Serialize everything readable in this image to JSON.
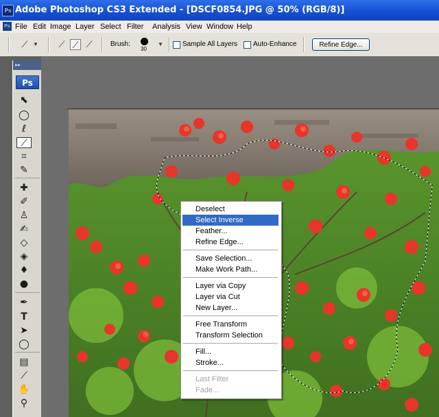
{
  "window": {
    "title": "Adobe Photoshop CS3 Extended - [DSCF0854.JPG @ 50% (RGB/8)]",
    "app_icon_text": "Ps"
  },
  "menubar": {
    "icon_text": "Ps",
    "items": [
      "File",
      "Edit",
      "Image",
      "Layer",
      "Select",
      "Filter",
      "Analysis",
      "View",
      "Window",
      "Help"
    ]
  },
  "options_bar": {
    "brush_label": "Brush:",
    "brush_size": "30",
    "sample_all_layers_label": "Sample All Layers",
    "sample_all_layers_checked": false,
    "auto_enhance_label": "Auto-Enhance",
    "auto_enhance_checked": false,
    "refine_edge_button": "Refine Edge..."
  },
  "toolbox": {
    "logo": "Ps",
    "tools": [
      "move-tool",
      "marquee-tool",
      "lasso-tool",
      "quick-selection-tool",
      "crop-tool",
      "slice-tool",
      "healing-brush-tool",
      "brush-tool",
      "clone-stamp-tool",
      "history-brush-tool",
      "eraser-tool",
      "paint-bucket-tool",
      "blur-tool",
      "dodge-tool",
      "pen-tool",
      "type-tool",
      "path-selection-tool",
      "shape-tool",
      "notes-tool",
      "eyedropper-tool",
      "hand-tool",
      "zoom-tool"
    ],
    "selected_tool": "quick-selection-tool"
  },
  "context_menu": {
    "items": [
      {
        "label": "Deselect",
        "state": "normal"
      },
      {
        "label": "Select Inverse",
        "state": "highlighted"
      },
      {
        "label": "Feather...",
        "state": "normal"
      },
      {
        "label": "Refine Edge...",
        "state": "normal"
      },
      {
        "label": "Save Selection...",
        "state": "normal"
      },
      {
        "label": "Make Work Path...",
        "state": "normal"
      },
      {
        "label": "Layer via Copy",
        "state": "normal"
      },
      {
        "label": "Layer via Cut",
        "state": "normal"
      },
      {
        "label": "New Layer...",
        "state": "normal"
      },
      {
        "label": "Free Transform",
        "state": "normal"
      },
      {
        "label": "Transform Selection",
        "state": "normal"
      },
      {
        "label": "Fill...",
        "state": "normal"
      },
      {
        "label": "Stroke...",
        "state": "normal"
      },
      {
        "label": "Last Filter",
        "state": "disabled"
      },
      {
        "label": "Fade...",
        "state": "disabled"
      }
    ]
  },
  "colors": {
    "titlebar": "#1550d4",
    "menu_highlight": "#316ac5",
    "flower_red": "#e8352a",
    "foliage_green": "#4f8a2a",
    "wall_gray": "#857b70"
  }
}
